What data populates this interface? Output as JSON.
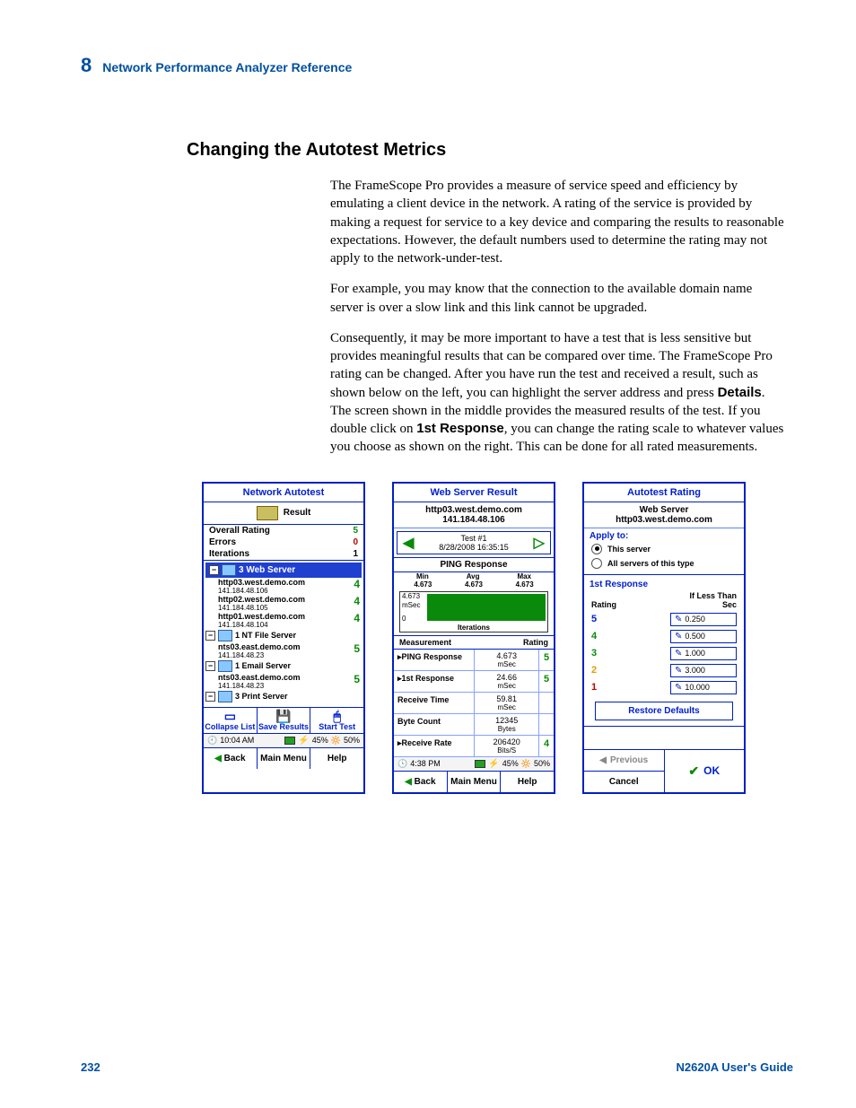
{
  "header": {
    "chapter_num": "8",
    "chapter_title": "Network Performance Analyzer Reference"
  },
  "section_heading": "Changing the Autotest Metrics",
  "paragraphs": {
    "p1": "The FrameScope Pro provides a measure of service speed and efficiency by emulating a client device in the network. A rating of the service is provided by making a request for service to a key device and comparing the results to reasonable expectations. However, the default numbers used to determine the rating may not apply to the network-under-test.",
    "p2": "For example, you may know that the connection to the available domain name server is over a slow link and this link cannot be upgraded.",
    "p3a": "Consequently, it may be more important to have a test that is less sensitive but provides meaningful results that can be compared over time. The FrameScope Pro rating can be changed. After you have run the test and received a result, such as shown below on the left, you can highlight the server address and press ",
    "p3_bold1": "Details",
    "p3b": ". The screen shown in the middle provides the measured results of the test. If you double click on ",
    "p3_bold2": "1st Response",
    "p3c": ", you can change the rating scale to whatever values you choose as shown on the right. This can be done for all rated measurements."
  },
  "left": {
    "title": "Network Autotest",
    "result_label": "Result",
    "overall": "Overall Rating",
    "overall_v": "5",
    "errors": "Errors",
    "errors_v": "0",
    "iter": "Iterations",
    "iter_v": "1",
    "g1": "3 Web Server",
    "s1n": "http03.west.demo.com",
    "s1ip": "141.184.48.106",
    "s1r": "4",
    "s2n": "http02.west.demo.com",
    "s2ip": "141.184.48.105",
    "s2r": "4",
    "s3n": "http01.west.demo.com",
    "s3ip": "141.184.48.104",
    "s3r": "4",
    "g2": "1 NT File Server",
    "s4n": "nts03.east.demo.com",
    "s4ip": "141.184.48.23",
    "s4r": "5",
    "g3": "1 Email Server",
    "s5n": "nts03.east.demo.com",
    "s5ip": "141.184.48.23",
    "s5r": "5",
    "g4": "3 Print Server",
    "btn_collapse": "Collapse List",
    "btn_save": "Save Results",
    "btn_start": "Start Test",
    "time": "10:04 AM",
    "batt": "45%",
    "bright": "50%",
    "nav_back": "Back",
    "nav_main": "Main Menu",
    "nav_help": "Help"
  },
  "mid": {
    "title": "Web Server Result",
    "host": "http03.west.demo.com",
    "ip": "141.184.48.106",
    "test_no": "Test #1",
    "test_ts": "8/28/2008 16:35:15",
    "ping_h": "PING Response",
    "min_l": "Min",
    "avg_l": "Avg",
    "max_l": "Max",
    "min_v": "4.673",
    "avg_v": "4.673",
    "max_v": "4.673",
    "y1": "4.673",
    "yu": "mSec",
    "y0": "0",
    "xlabel": "Iterations",
    "meas_h": "Measurement",
    "rate_h": "Rating",
    "m1": "PING Response",
    "m1v": "4.673",
    "m1u": "mSec",
    "m1r": "5",
    "m2": "1st Response",
    "m2v": "24.66",
    "m2u": "mSec",
    "m2r": "5",
    "m3": "Receive Time",
    "m3v": "59.81",
    "m3u": "mSec",
    "m4": "Byte Count",
    "m4v": "12345",
    "m4u": "Bytes",
    "m5": "Receive Rate",
    "m5v": "206420",
    "m5u": "Bits/S",
    "m5r": "4",
    "time": "4:38 PM",
    "batt": "45%",
    "bright": "50%",
    "nav_back": "Back",
    "nav_main": "Main Menu",
    "nav_help": "Help"
  },
  "right": {
    "title": "Autotest Rating",
    "sub1": "Web Server",
    "sub2": "http03.west.demo.com",
    "apply": "Apply to:",
    "opt1": "This server",
    "opt2": "All servers of this type",
    "first": "1st Response",
    "rate_lbl": "Rating",
    "ilt": "If Less Than",
    "sec": "Sec",
    "r5": "5",
    "v5": "0.250",
    "r4": "4",
    "v4": "0.500",
    "r3": "3",
    "v3": "1.000",
    "r2": "2",
    "v2": "3.000",
    "r1": "1",
    "v1": "10.000",
    "restore": "Restore Defaults",
    "prev": "Previous",
    "cancel": "Cancel",
    "ok": "OK"
  },
  "footer": {
    "page": "232",
    "guide": "N2620A User's Guide"
  },
  "chart_data": {
    "type": "bar",
    "title": "PING Response",
    "xlabel": "Iterations",
    "ylabel": "mSec",
    "ylim": [
      0,
      4.673
    ],
    "categories": [
      "1"
    ],
    "values": [
      4.673
    ],
    "stats": {
      "min": 4.673,
      "avg": 4.673,
      "max": 4.673
    }
  }
}
